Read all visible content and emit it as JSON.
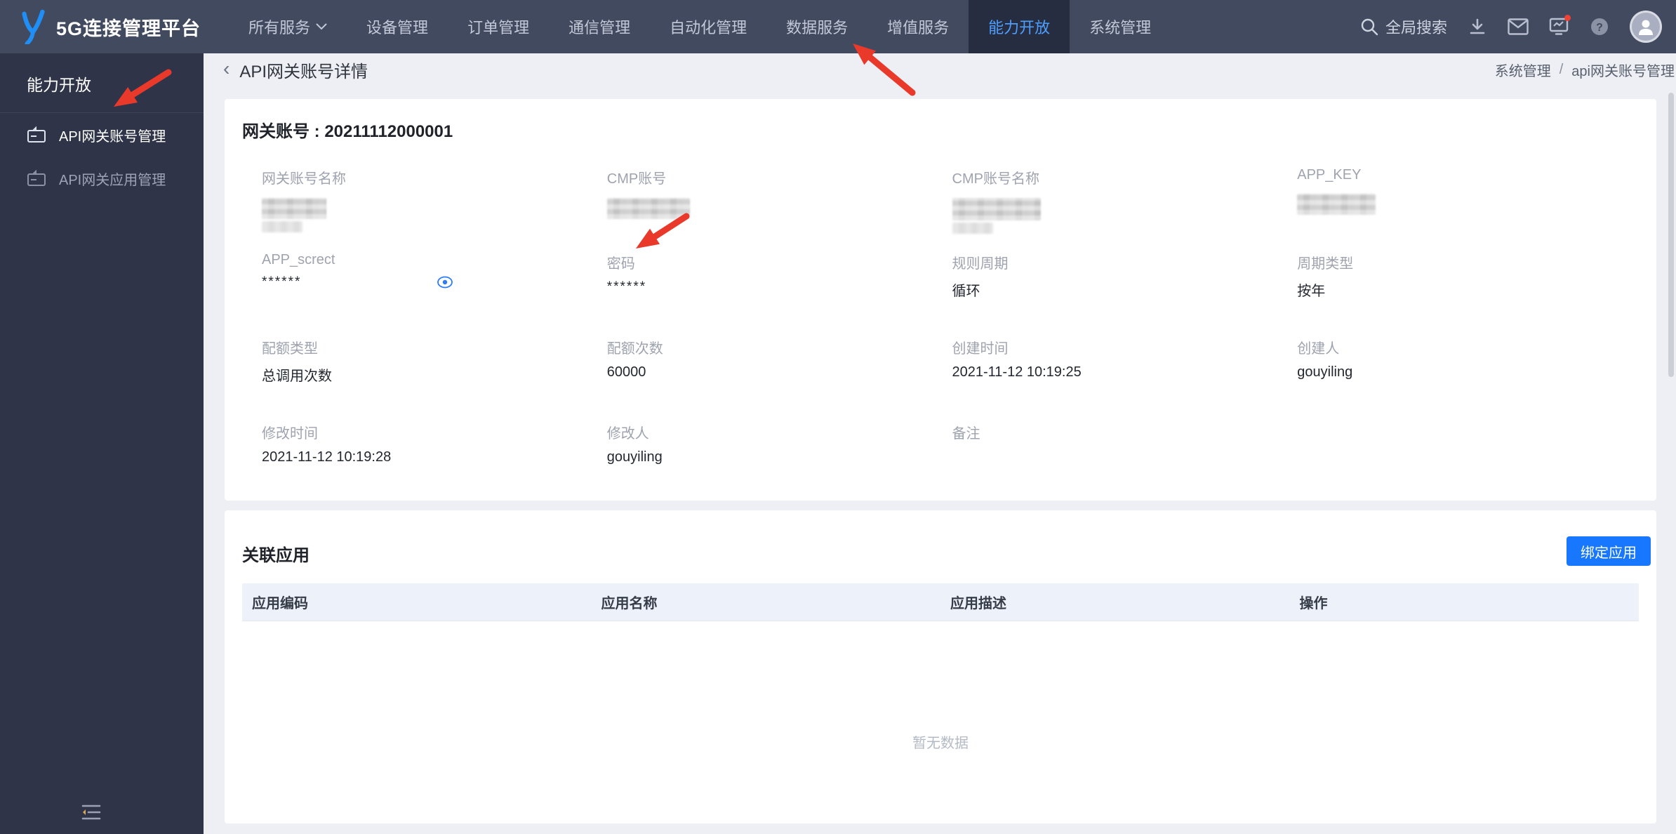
{
  "navbar": {
    "logo_text": "5G连接管理平台",
    "menu": [
      {
        "label": "所有服务",
        "active": false,
        "has_caret": true
      },
      {
        "label": "设备管理",
        "active": false
      },
      {
        "label": "订单管理",
        "active": false
      },
      {
        "label": "通信管理",
        "active": false
      },
      {
        "label": "自动化管理",
        "active": false
      },
      {
        "label": "数据服务",
        "active": false
      },
      {
        "label": "增值服务",
        "active": false
      },
      {
        "label": "能力开放",
        "active": true
      },
      {
        "label": "系统管理",
        "active": false
      }
    ],
    "search_label": "全局搜索",
    "notification_badge": true
  },
  "sidebar": {
    "title": "能力开放",
    "items": [
      {
        "label": "API网关账号管理",
        "active": true
      },
      {
        "label": "API网关应用管理",
        "active": false
      }
    ]
  },
  "page": {
    "title": "API网关账号详情",
    "back_chevron": "‹",
    "breadcrumb": {
      "parent": "系统管理",
      "separator": "/",
      "current": "api网关账号管理"
    }
  },
  "detail_card": {
    "account_title": "网关账号 : 20211112000001",
    "fields": [
      {
        "label": "网关账号名称",
        "value": "",
        "masked": true
      },
      {
        "label": "CMP账号",
        "value": "",
        "masked": true
      },
      {
        "label": "CMP账号名称",
        "value": "",
        "masked": true
      },
      {
        "label": "APP_KEY",
        "value": "",
        "masked": true
      },
      {
        "label": "APP_screct",
        "value": "******",
        "has_eye_icon": true
      },
      {
        "label": "密码",
        "value": "******"
      },
      {
        "label": "规则周期",
        "value": "循环"
      },
      {
        "label": "周期类型",
        "value": "按年"
      },
      {
        "label": "配额类型",
        "value": "总调用次数"
      },
      {
        "label": "配额次数",
        "value": "60000"
      },
      {
        "label": "创建时间",
        "value": "2021-11-12 10:19:25"
      },
      {
        "label": "创建人",
        "value": "gouyiling"
      },
      {
        "label": "修改时间",
        "value": "2021-11-12 10:19:28"
      },
      {
        "label": "修改人",
        "value": "gouyiling"
      },
      {
        "label": "备注",
        "value": ""
      }
    ]
  },
  "apps_card": {
    "title": "关联应用",
    "bind_button_label": "绑定应用",
    "table": {
      "headers": [
        "应用编码",
        "应用名称",
        "应用描述",
        "操作"
      ],
      "rows": [],
      "empty_text": "暂无数据"
    }
  },
  "colors": {
    "accent_blue": "#1777ff",
    "nav_active_text": "#4e9eff",
    "arrow_red": "#e8392a",
    "navbar_bg": "#424a5f",
    "sidebar_bg": "#2f3448",
    "page_bg": "#edeff4",
    "table_header_bg": "#edf1fa"
  }
}
